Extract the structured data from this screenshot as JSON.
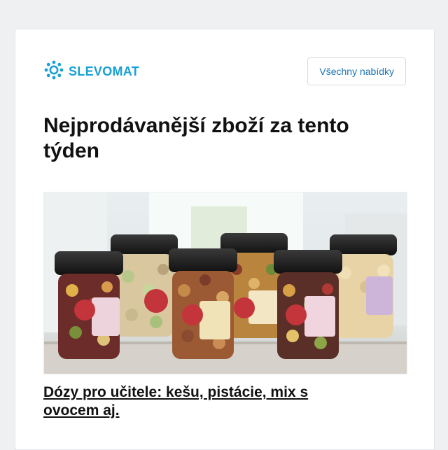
{
  "brand": {
    "name": "SLEVOMAT",
    "logo_icon": "gear-icon",
    "color": "#1aa0d4"
  },
  "header": {
    "offers_button_label": "Všechny nabídky"
  },
  "main": {
    "headline": "Nejprodávanější zboží za tento týden",
    "product": {
      "image_icon": "nut-jars-photo",
      "title": "Dózy pro učitele: kešu, pistácie, mix s ovocem aj."
    }
  },
  "colors": {
    "accent": "#1a73b5",
    "page_bg": "#eef0f2"
  }
}
